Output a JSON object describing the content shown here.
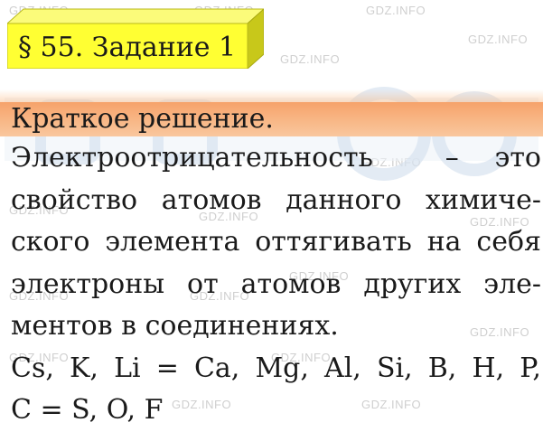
{
  "watermark": "GDZ.INFO",
  "title": "§ 55. Задание 1",
  "section_label": "Краткое решение.",
  "body": {
    "line1": [
      "Электроотрицательность",
      "–",
      "это"
    ],
    "line2": [
      "свойство",
      "атомов",
      "данного",
      "химиче-"
    ],
    "line3": [
      "ского",
      "элемента",
      "оттягивать",
      "на",
      "себя"
    ],
    "line4": [
      "электроны",
      "от",
      "атомов",
      "других",
      "эле-"
    ],
    "line5": "ментов в соединениях.",
    "line6": [
      "Cs,",
      "K,",
      "Li",
      "=",
      "Ca,",
      "Mg,",
      "Al,",
      "Si,",
      "B,",
      "H,",
      "P,"
    ],
    "line7": "C = S, O, F"
  },
  "colors": {
    "title_box": "#ffff33",
    "title_box_side": "#c8c81a",
    "header_band": "#f6a26a"
  }
}
